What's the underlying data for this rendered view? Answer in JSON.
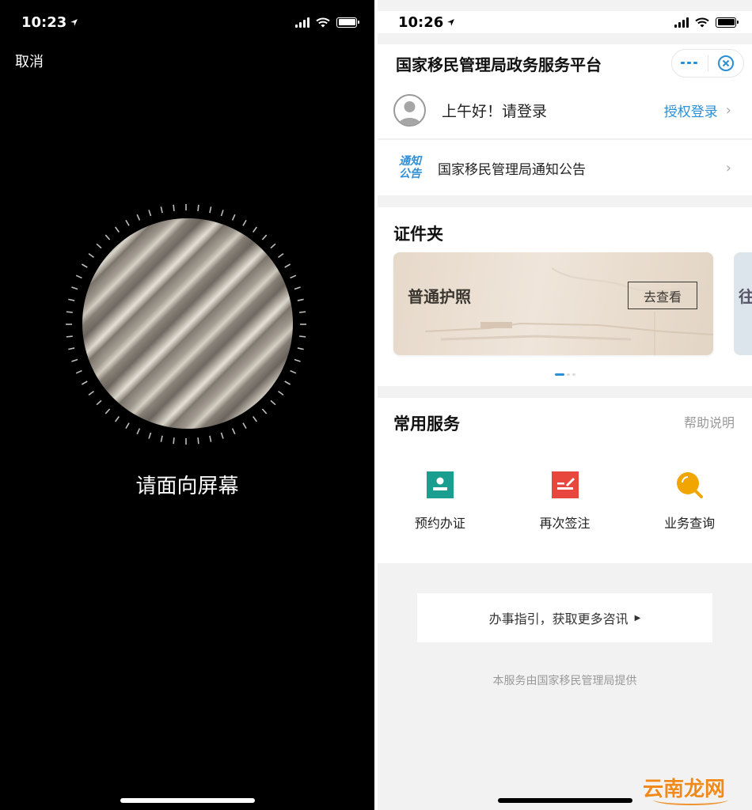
{
  "left": {
    "status": {
      "time": "10:23"
    },
    "cancel_label": "取消",
    "prompt": "请面向屏幕",
    "colors": {
      "background": "#000000",
      "text": "#ffffff"
    }
  },
  "right": {
    "status": {
      "time": "10:26"
    },
    "header": {
      "title": "国家移民管理局政务服务平台"
    },
    "login": {
      "greeting": "上午好！请登录",
      "link": "授权登录"
    },
    "notice": {
      "badge_line1": "通知",
      "badge_line2": "公告",
      "text": "国家移民管理局通知公告"
    },
    "documents": {
      "title": "证件夹",
      "cards": [
        {
          "title": "普通护照",
          "button": "去查看"
        }
      ],
      "peek_char": "往",
      "active_dot": 0,
      "dot_count": 3
    },
    "services": {
      "title": "常用服务",
      "help_link": "帮助说明",
      "items": [
        {
          "label": "预约办证",
          "icon": "id-card-icon",
          "color": "#1a9e8f"
        },
        {
          "label": "再次签注",
          "icon": "edit-document-icon",
          "color": "#e8473e"
        },
        {
          "label": "业务查询",
          "icon": "search-icon",
          "color": "#f0a500"
        }
      ]
    },
    "guide_button": "办事指引，获取更多咨讯",
    "footer_note": "本服务由国家移民管理局提供",
    "colors": {
      "accent": "#2b8fd6",
      "page_bg": "#f2f2f2"
    }
  },
  "watermark": "云南龙网"
}
